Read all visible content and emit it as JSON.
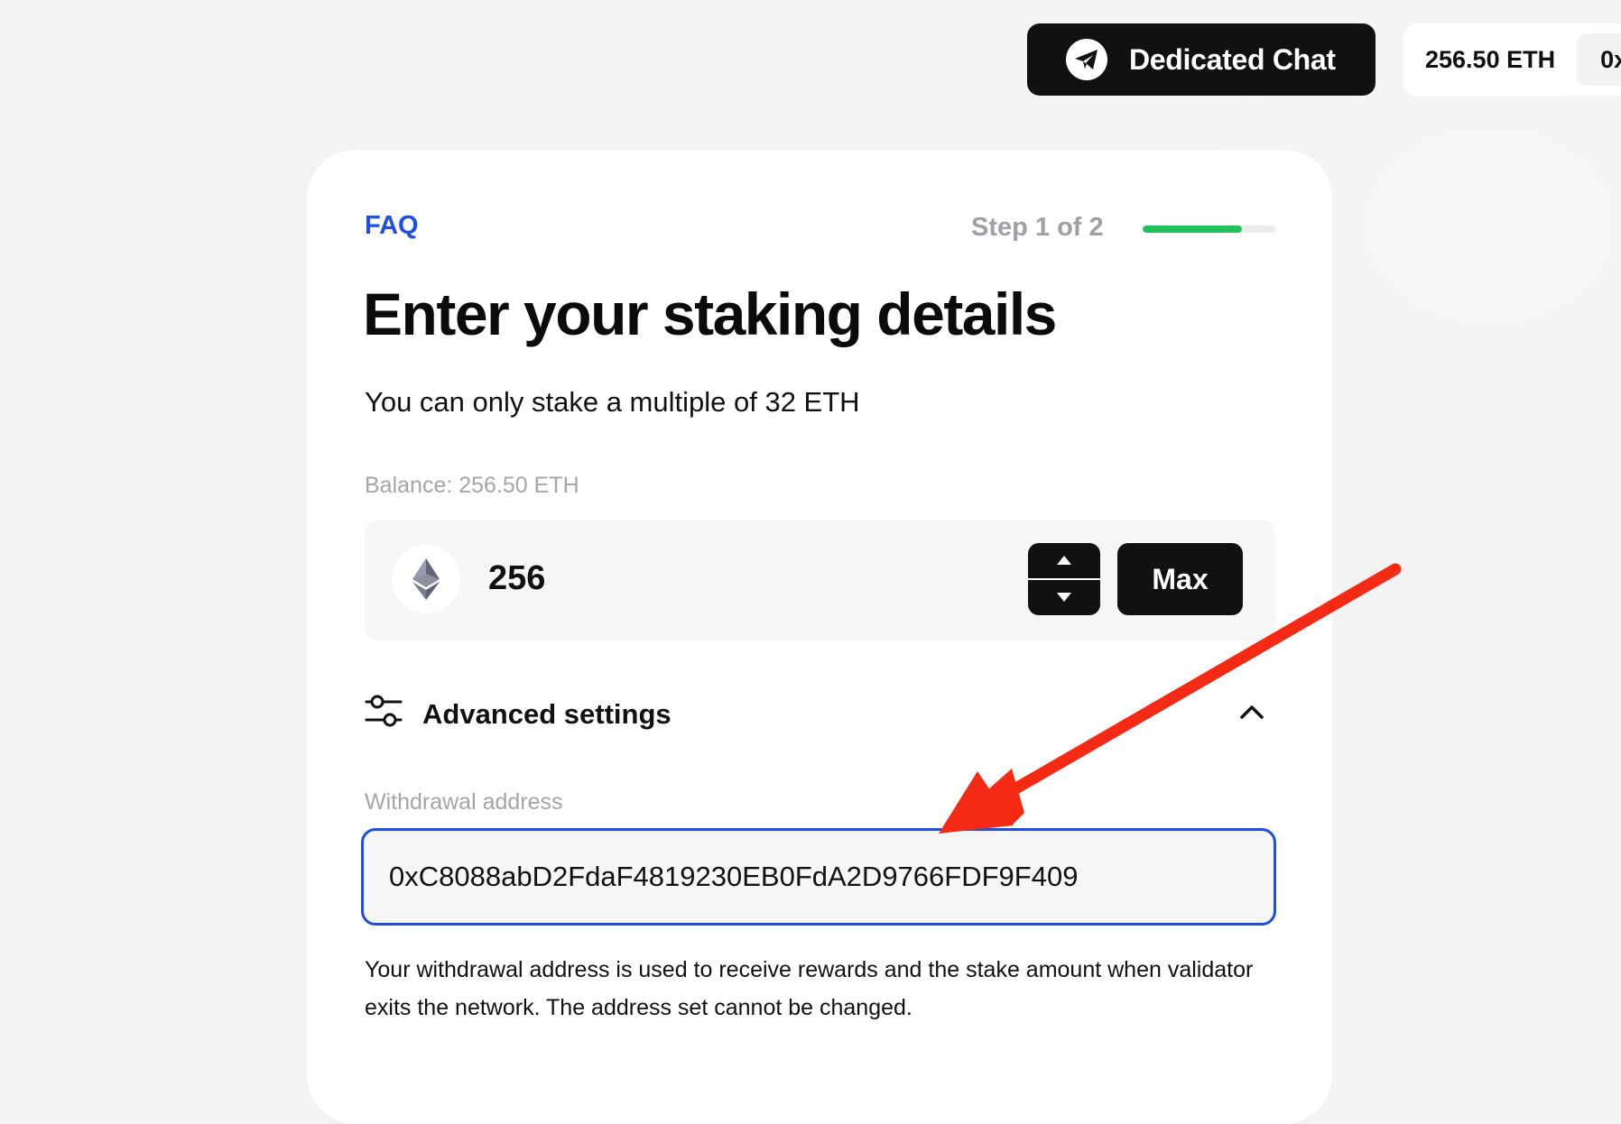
{
  "header": {
    "chat_button_label": "Dedicated Chat",
    "chat_icon": "telegram-icon",
    "wallet_balance": "256.50 ETH",
    "wallet_address_partial": "0x"
  },
  "card": {
    "faq_label": "FAQ",
    "step_label": "Step 1 of 2",
    "progress_fraction": 0.75,
    "title": "Enter your staking details",
    "subtitle": "You can only stake a multiple of 32 ETH",
    "balance_label": "Balance: 256.50 ETH",
    "amount": {
      "icon": "ethereum-icon",
      "value": "256",
      "stepper_icons": [
        "triangle-up-icon",
        "triangle-down-icon"
      ],
      "max_label": "Max"
    },
    "advanced": {
      "icon": "sliders-icon",
      "label": "Advanced settings",
      "expanded": true,
      "chevron_icon": "chevron-up-icon"
    },
    "withdrawal": {
      "label": "Withdrawal address",
      "value": "0xC8088abD2FdaF4819230EB0FdA2D9766FDF9F409",
      "help_text": "Your withdrawal address is used to receive rewards and the stake amount when validator exits the network. The address set cannot be changed."
    }
  },
  "colors": {
    "accent_blue": "#1d4ee6",
    "progress_green": "#22c25a",
    "annotation_red": "#f52a14",
    "button_dark": "#111111"
  }
}
